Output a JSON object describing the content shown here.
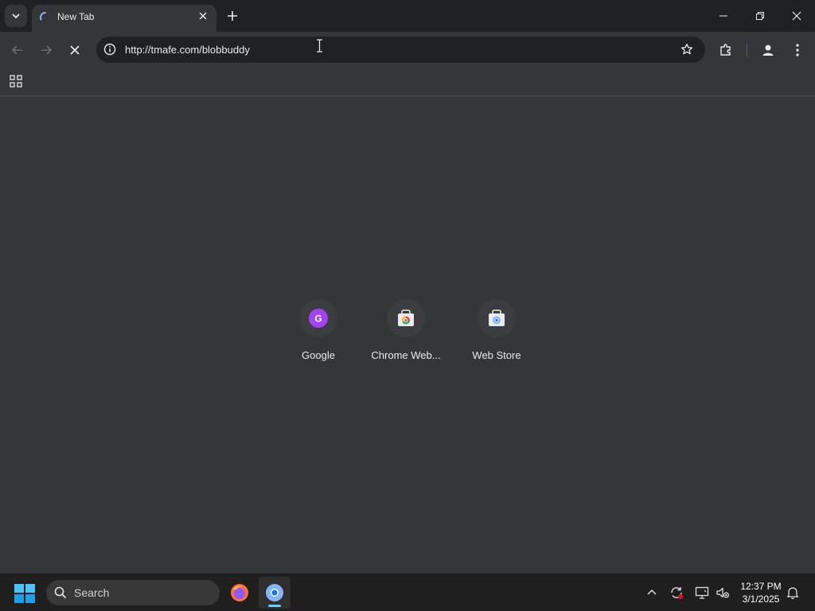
{
  "browser": {
    "tab": {
      "title": "New Tab"
    },
    "address_bar": {
      "url": "http://tmafe.com/blobbuddy"
    }
  },
  "shortcuts": [
    {
      "label": "Google",
      "icon": "google-favicon",
      "letter": "G"
    },
    {
      "label": "Chrome Web...",
      "icon": "chrome-web-store-icon"
    },
    {
      "label": "Web Store",
      "icon": "web-store-icon"
    }
  ],
  "taskbar": {
    "search_label": "Search",
    "apps": [
      {
        "name": "firefox-icon"
      },
      {
        "name": "chrome-icon",
        "active": true
      }
    ],
    "clock": {
      "time": "12:37 PM",
      "date": "3/1/2025"
    }
  },
  "colors": {
    "accent": "#8ab4f8",
    "google_avatar": "#a142f4",
    "taskbar_indicator": "#60cdff"
  }
}
